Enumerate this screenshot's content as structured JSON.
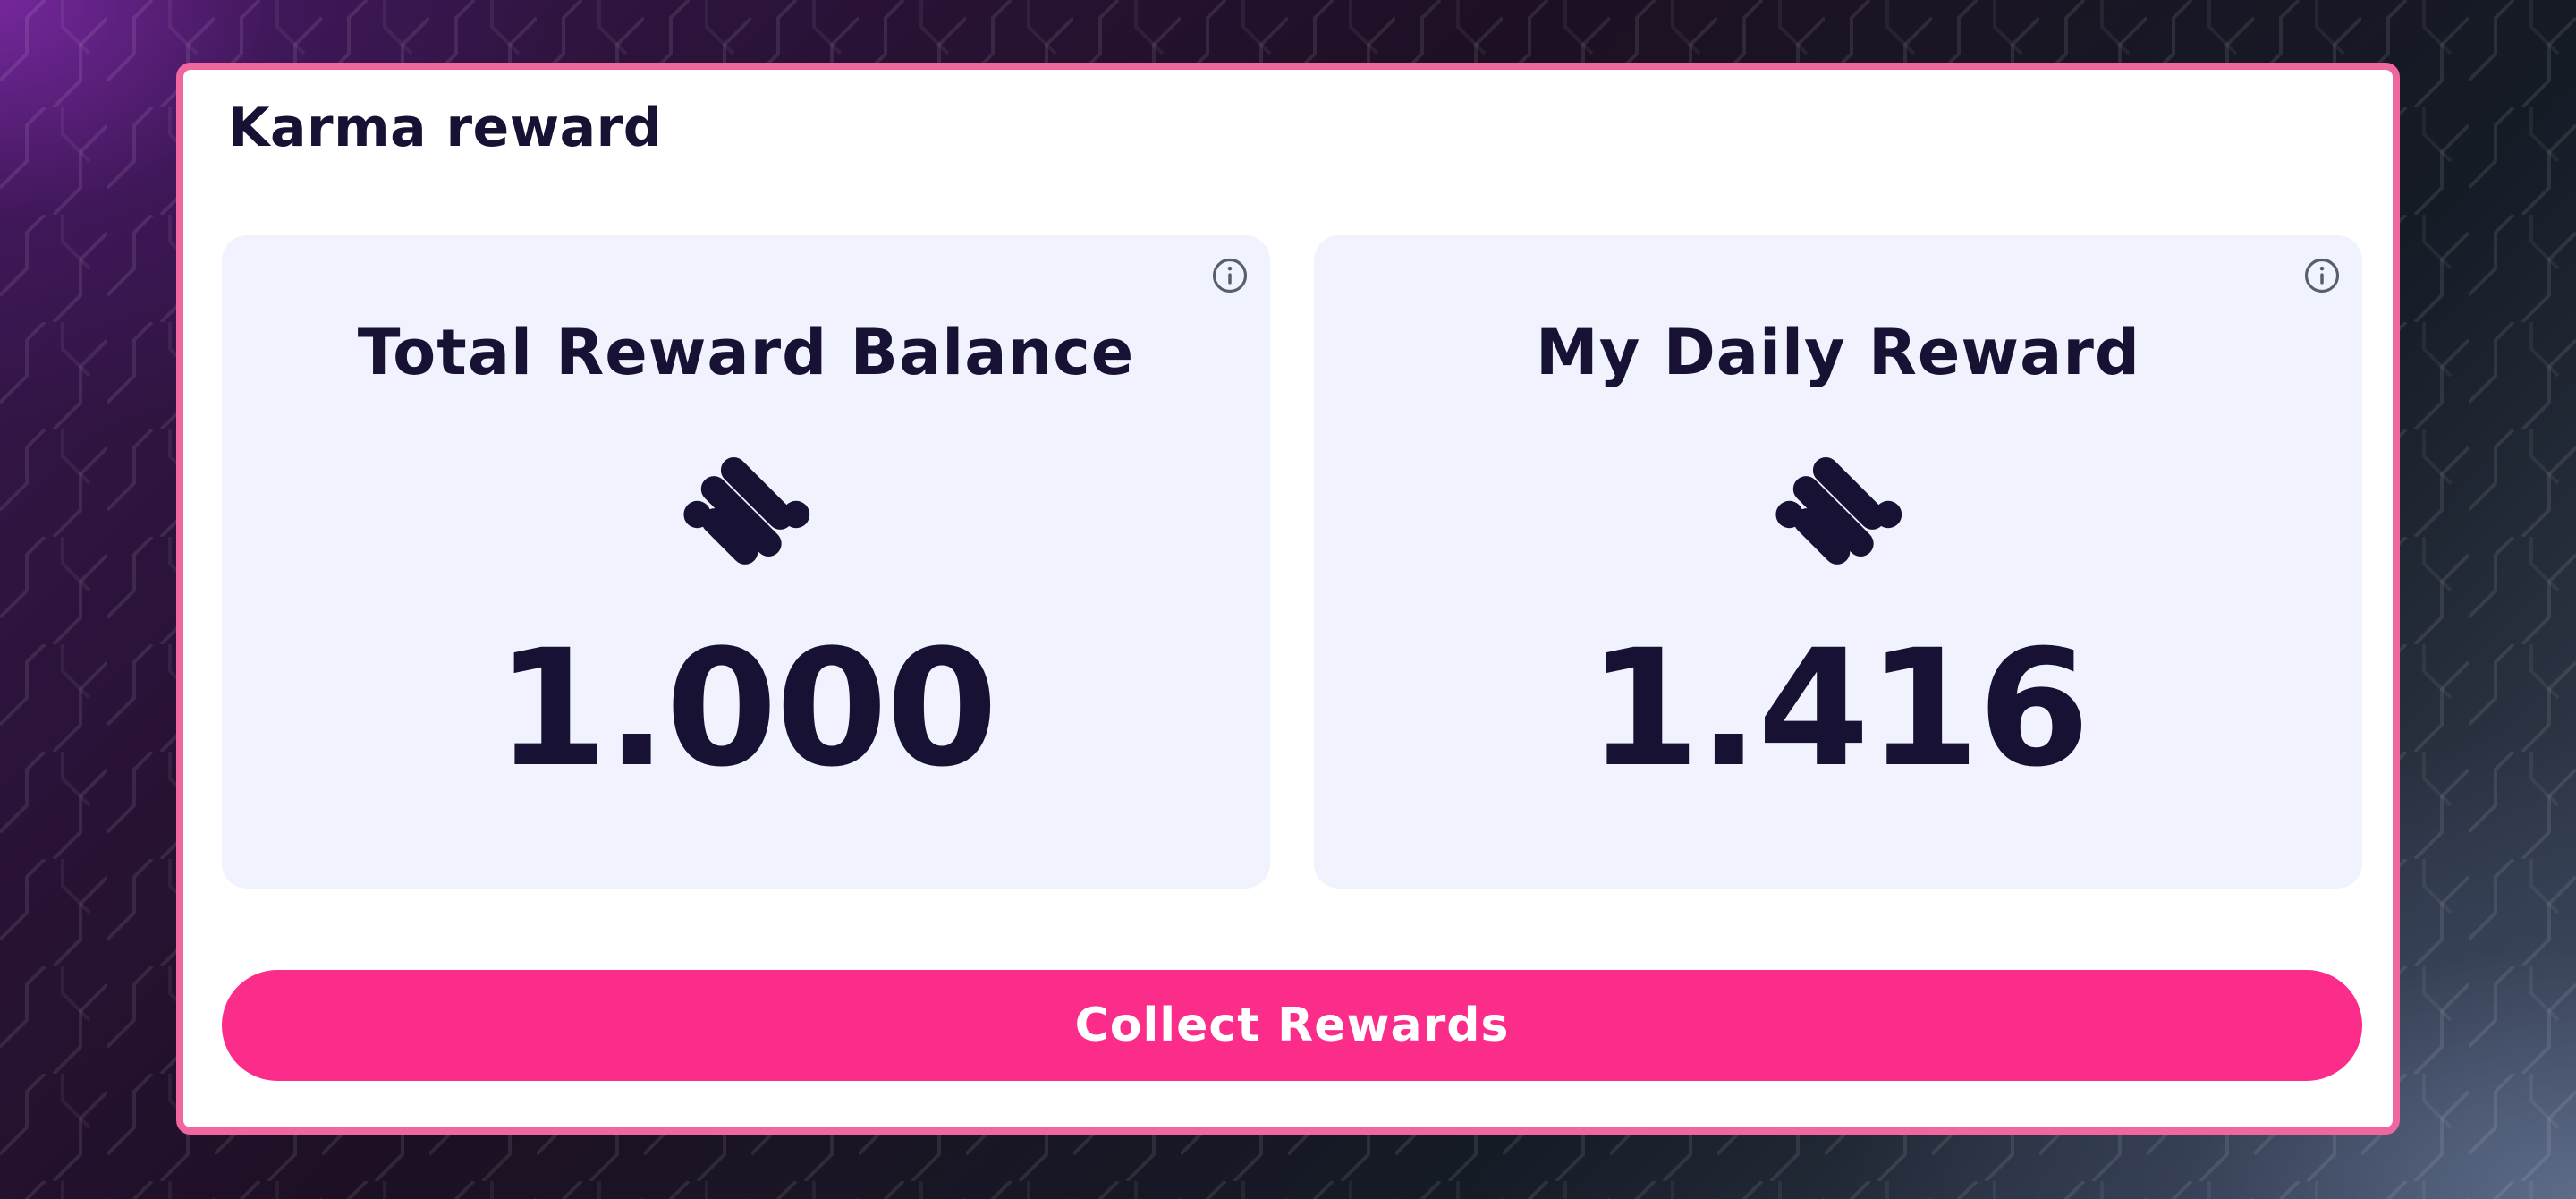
{
  "panel": {
    "title": "Karma reward"
  },
  "cards": [
    {
      "title": "Total Reward Balance",
      "value": "1.000",
      "icon": "karma-token-icon",
      "info_icon": "info-icon"
    },
    {
      "title": "My Daily Reward",
      "value": "1.416",
      "icon": "karma-token-icon",
      "info_icon": "info-icon"
    }
  ],
  "actions": {
    "collect_label": "Collect Rewards"
  },
  "colors": {
    "accent": "#fc2d8a",
    "panel_border": "#f0679f",
    "card_bg": "#f0f3fd",
    "text": "#171234"
  }
}
